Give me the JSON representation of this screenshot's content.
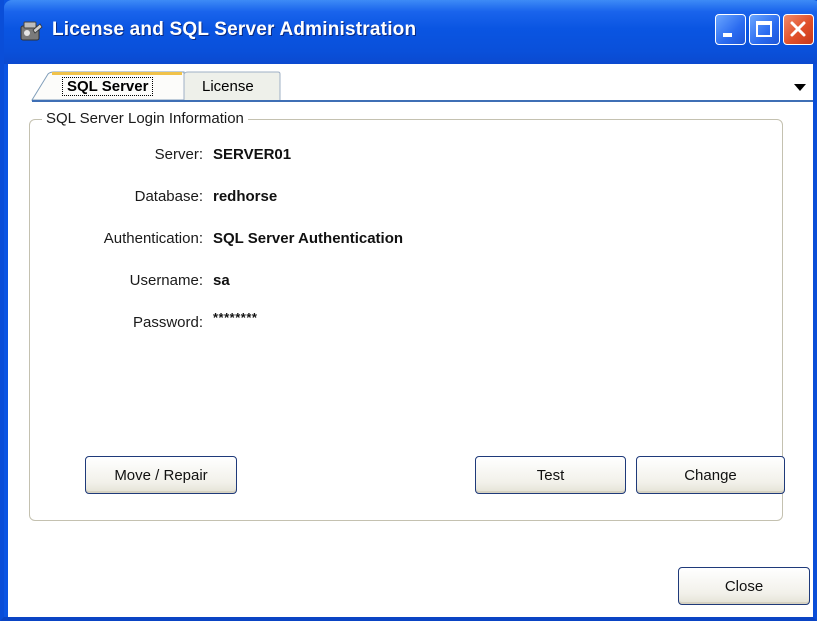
{
  "window": {
    "title": "License and SQL Server Administration",
    "controls": {
      "minimize": "minimize",
      "maximize": "maximize",
      "close": "close"
    }
  },
  "tabs": [
    {
      "label": "SQL Server",
      "active": true
    },
    {
      "label": "License",
      "active": false
    }
  ],
  "group": {
    "legend": "SQL Server Login Information",
    "fields": [
      {
        "label": "Server:",
        "value": "SERVER01"
      },
      {
        "label": "Database:",
        "value": "redhorse"
      },
      {
        "label": "Authentication:",
        "value": "SQL Server Authentication"
      },
      {
        "label": "Username:",
        "value": "sa"
      },
      {
        "label": "Password:",
        "value": "********"
      }
    ],
    "buttons": {
      "move_repair": "Move / Repair",
      "test": "Test",
      "change": "Change"
    }
  },
  "footer": {
    "close": "Close"
  },
  "colors": {
    "title_bar": "#0a55e2",
    "close_button": "#e0502a",
    "tab_line": "#3f6fb5"
  }
}
